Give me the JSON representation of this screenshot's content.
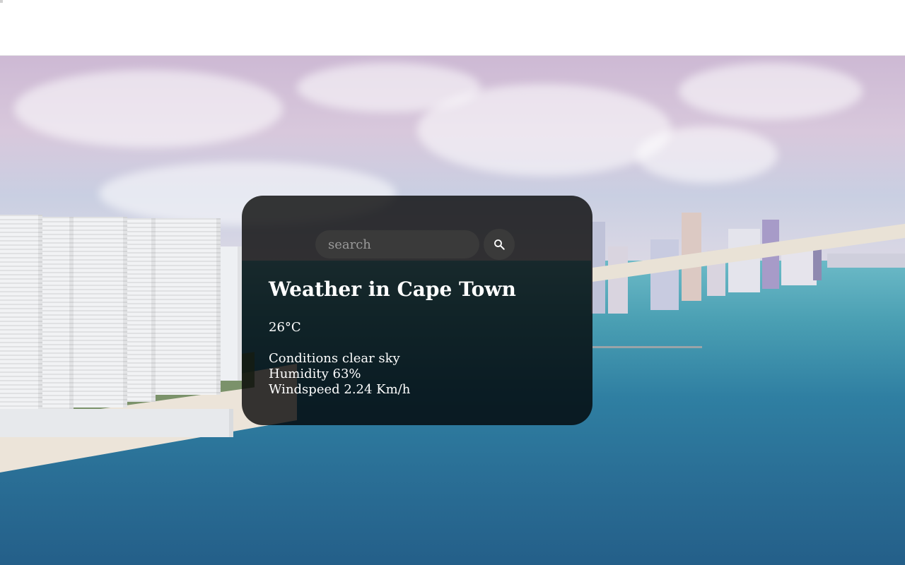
{
  "search": {
    "placeholder": "search",
    "value": ""
  },
  "weather": {
    "title": "Weather in Cape Town",
    "temperature": "26°C",
    "conditions": "Conditions clear sky",
    "humidity": "Humidity 63%",
    "windspeed": "Windspeed 2.24 Km/h"
  },
  "icons": {
    "search_button": "search-icon"
  },
  "colors": {
    "card_background": "#000000c7",
    "input_background": "#3a3a3a",
    "text": "#ffffff"
  }
}
